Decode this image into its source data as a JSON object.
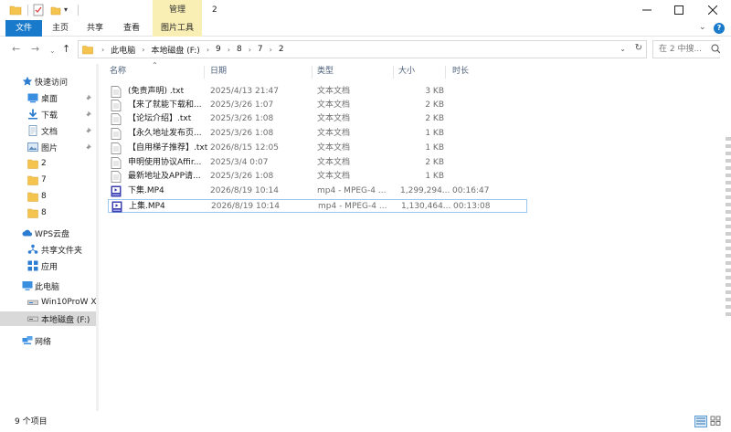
{
  "window": {
    "title": "2",
    "manage_tab": "管理",
    "min_icon": "minimize-icon",
    "max_icon": "maximize-icon",
    "close_icon": "close-icon"
  },
  "ribbon": {
    "file": "文件",
    "tabs": [
      "主页",
      "共享",
      "查看"
    ],
    "picture_tools": "图片工具"
  },
  "address": {
    "crumbs": [
      "此电脑",
      "本地磁盘 (F:)",
      "9",
      "8",
      "7",
      "2"
    ]
  },
  "search": {
    "placeholder": "在 2 中搜..."
  },
  "sidebar": {
    "quick_access": "快速访问",
    "items": [
      {
        "label": "桌面",
        "icon": "desktop-icon",
        "pinned": true
      },
      {
        "label": "下载",
        "icon": "download-icon",
        "pinned": true
      },
      {
        "label": "文档",
        "icon": "documents-icon",
        "pinned": true
      },
      {
        "label": "图片",
        "icon": "pictures-icon",
        "pinned": true
      },
      {
        "label": "2",
        "icon": "folder-icon"
      },
      {
        "label": "7",
        "icon": "folder-icon"
      },
      {
        "label": "8",
        "icon": "folder-icon"
      },
      {
        "label": "8",
        "icon": "folder-icon"
      }
    ],
    "wps": "WPS云盘",
    "wps_children": [
      "共享文件夹",
      "应用"
    ],
    "this_pc": "此电脑",
    "drives": [
      "Win10ProW X",
      "本地磁盘 (F:)"
    ],
    "network": "网络"
  },
  "columns": {
    "name": "名称",
    "date": "日期",
    "type": "类型",
    "size": "大小",
    "duration": "时长"
  },
  "files": [
    {
      "name": "(免责声明) .txt",
      "date": "2025/4/13 21:47",
      "type": "文本文档",
      "size": "3 KB",
      "duration": "",
      "kind": "txt"
    },
    {
      "name": "【来了就能下载和...",
      "date": "2025/3/26 1:07",
      "type": "文本文档",
      "size": "2 KB",
      "duration": "",
      "kind": "txt"
    },
    {
      "name": "【论坛介绍】.txt",
      "date": "2025/3/26 1:08",
      "type": "文本文档",
      "size": "2 KB",
      "duration": "",
      "kind": "txt"
    },
    {
      "name": "【永久地址发布页...",
      "date": "2025/3/26 1:08",
      "type": "文本文档",
      "size": "1 KB",
      "duration": "",
      "kind": "txt"
    },
    {
      "name": "【自用梯子推荐】.txt",
      "date": "2026/8/15 12:05",
      "type": "文本文档",
      "size": "1 KB",
      "duration": "",
      "kind": "txt"
    },
    {
      "name": "申明使用协议Affir...",
      "date": "2025/3/4 0:07",
      "type": "文本文档",
      "size": "2 KB",
      "duration": "",
      "kind": "txt"
    },
    {
      "name": "最新地址及APP请...",
      "date": "2025/3/26 1:08",
      "type": "文本文档",
      "size": "1 KB",
      "duration": "",
      "kind": "txt"
    },
    {
      "name": "下集.MP4",
      "date": "2026/8/19 10:14",
      "type": "mp4 - MPEG-4 ...",
      "size": "1,299,294...",
      "duration": "00:16:47",
      "kind": "mp4"
    },
    {
      "name": "上集.MP4",
      "date": "2026/8/19 10:14",
      "type": "mp4 - MPEG-4 ...",
      "size": "1,130,464...",
      "duration": "00:13:08",
      "kind": "mp4"
    }
  ],
  "status": {
    "count": "9 个项目"
  },
  "colors": {
    "accent": "#1979ca",
    "manage_bg": "#f9efb4",
    "selected": "#d9d9d9",
    "header_text": "#4c607a"
  }
}
